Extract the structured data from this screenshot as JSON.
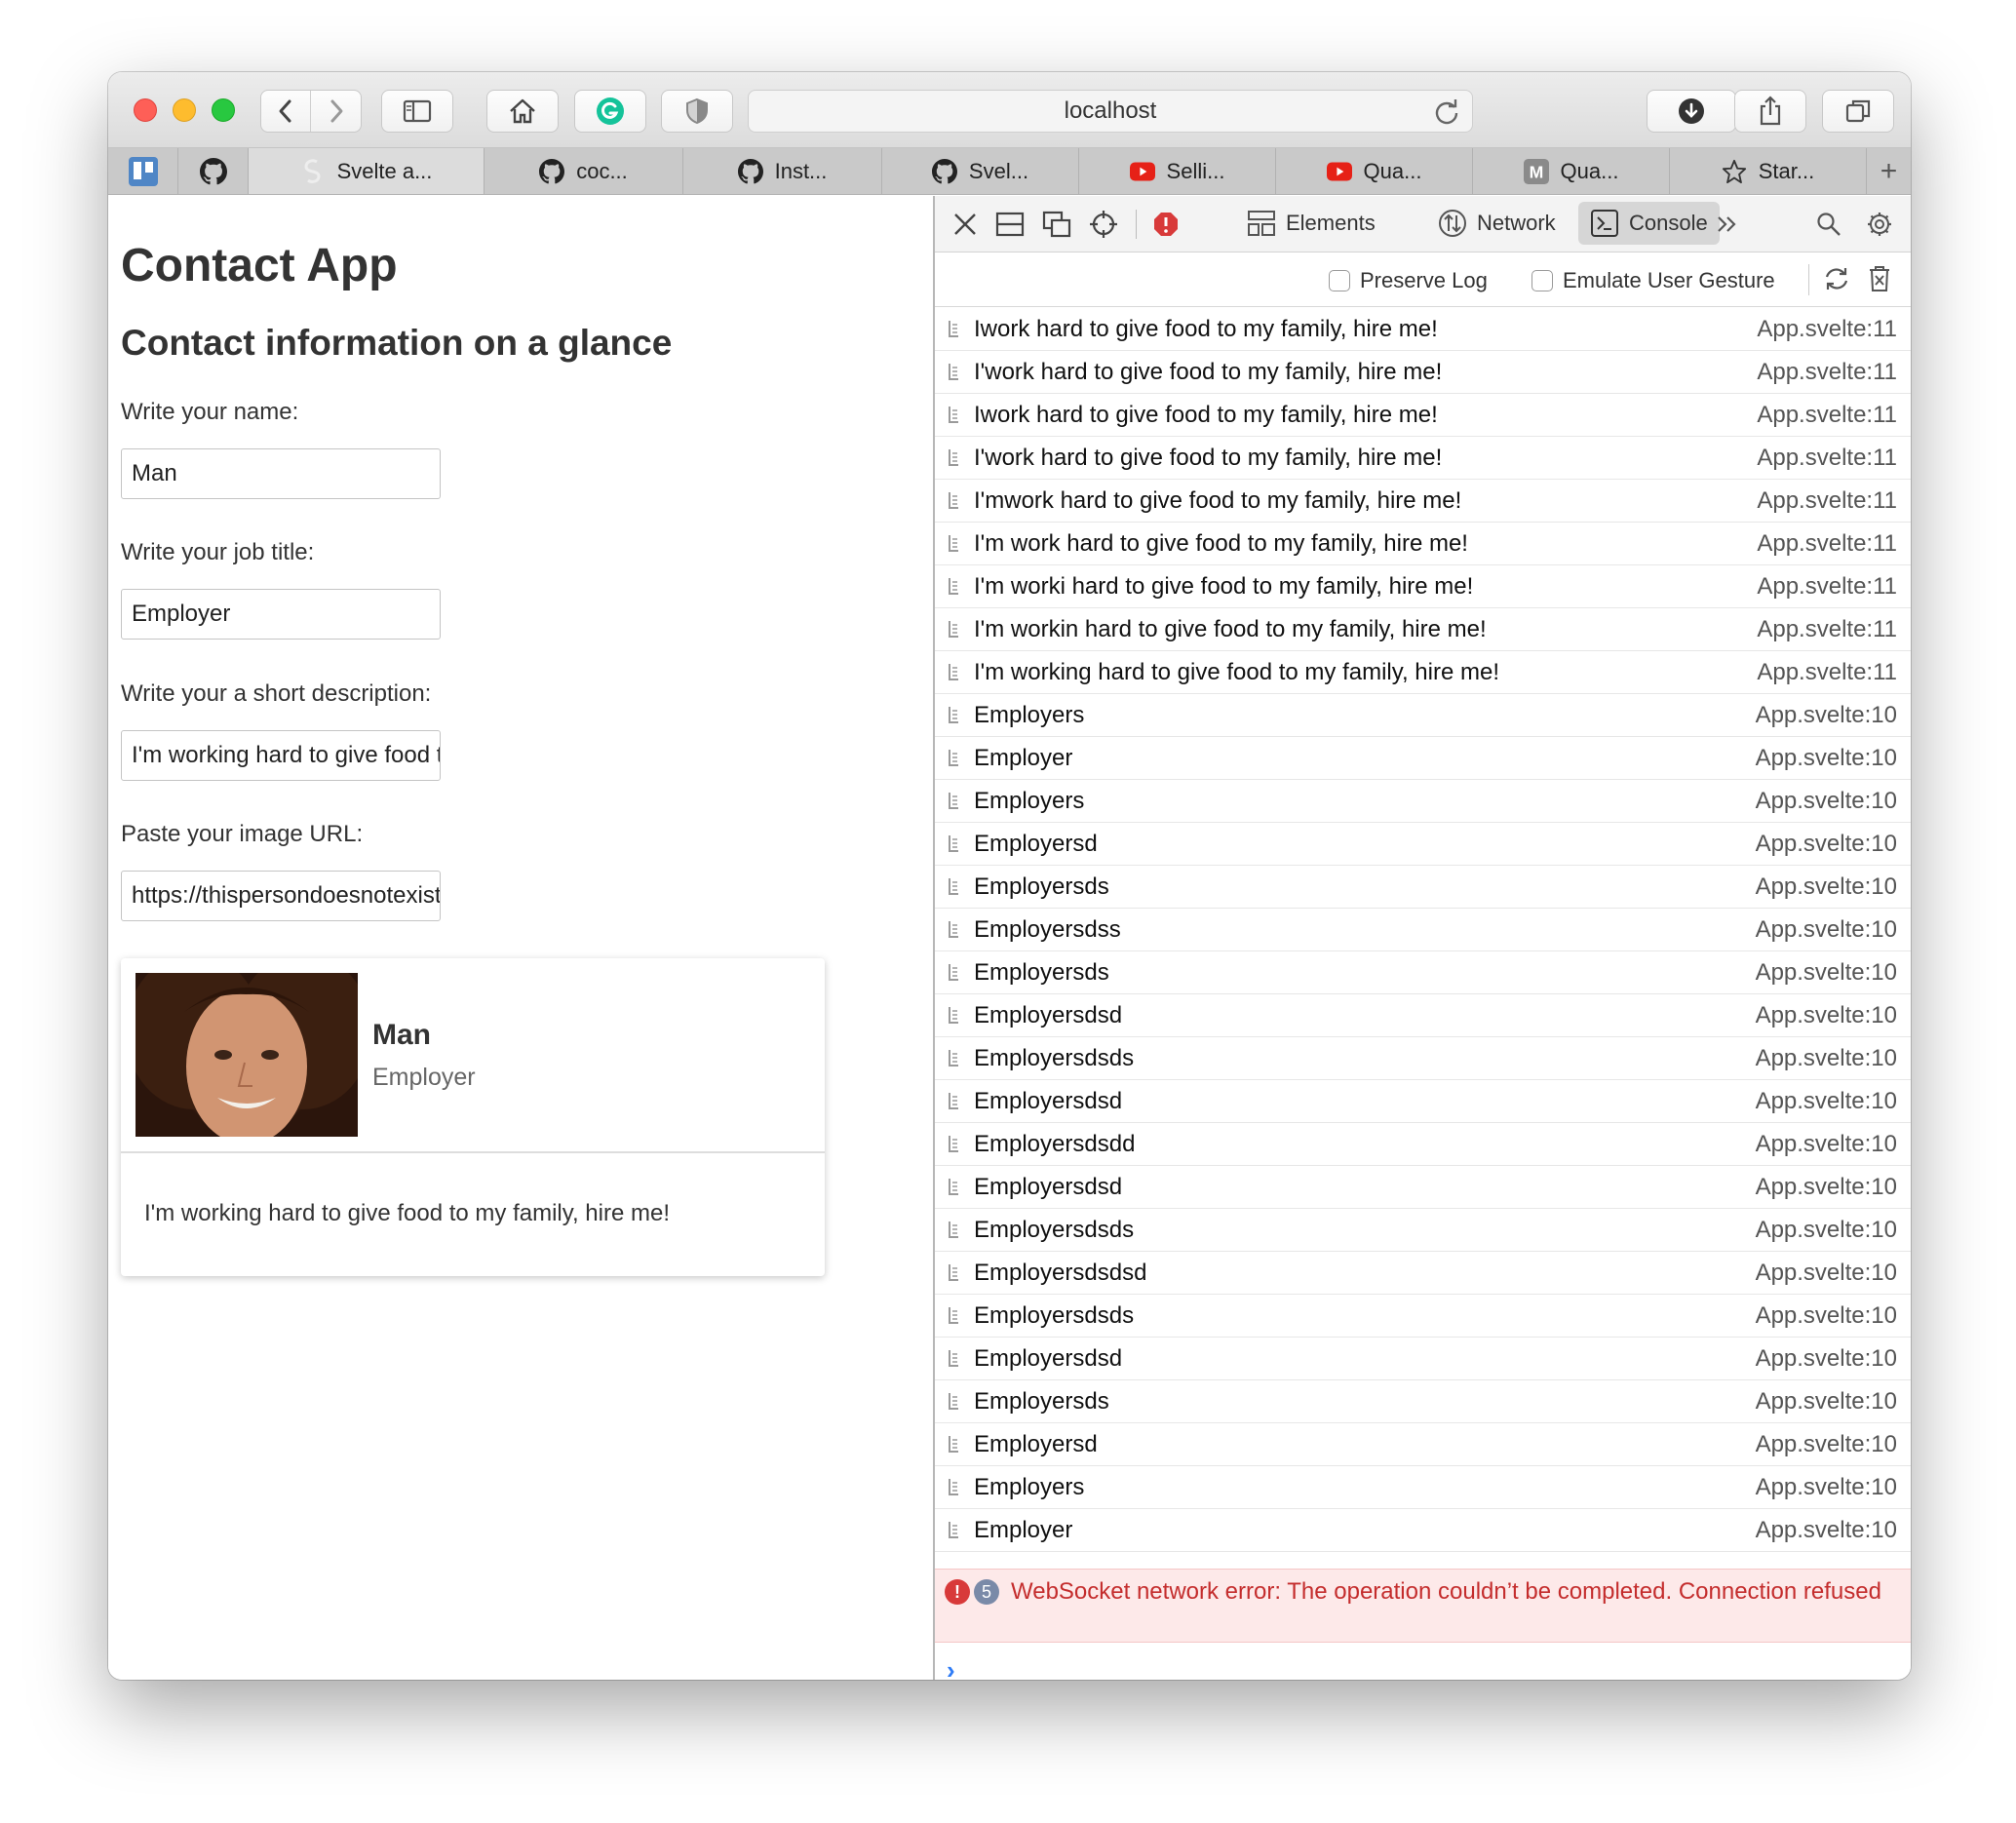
{
  "browser": {
    "url": "localhost",
    "tabs": [
      {
        "label": "Svelte a...",
        "icon": "svelte-icon",
        "active": true
      },
      {
        "label": "coc...",
        "icon": "github-icon"
      },
      {
        "label": "Inst...",
        "icon": "github-icon"
      },
      {
        "label": "Svel...",
        "icon": "github-icon"
      },
      {
        "label": "Selli...",
        "icon": "youtube-icon"
      },
      {
        "label": "Qua...",
        "icon": "youtube-icon"
      },
      {
        "label": "Qua...",
        "icon": "m-icon"
      },
      {
        "label": "Star...",
        "icon": "star-icon"
      }
    ],
    "new_tab": "+"
  },
  "page": {
    "title": "Contact App",
    "subtitle": "Contact information on a glance",
    "name_label": "Write your name:",
    "name_value": "Man",
    "job_label": "Write your job title:",
    "job_value": "Employer",
    "desc_label": "Write your a short description:",
    "desc_value": "I'm working hard to give food to my family, hire me!",
    "image_label": "Paste your image URL:",
    "image_value": "https://thispersondoesnotexist.com/image",
    "card": {
      "name": "Man",
      "job": "Employer",
      "description": "I'm working hard to give food to my family, hire me!"
    }
  },
  "devtools": {
    "tabs": {
      "elements": "Elements",
      "network": "Network",
      "console": "Console"
    },
    "preserve_log": "Preserve Log",
    "emulate_gesture": "Emulate User Gesture",
    "logs": [
      {
        "msg": "Iwork hard to give food to my family, hire me!",
        "src": "App.svelte:11"
      },
      {
        "msg": "I'work hard to give food to my family, hire me!",
        "src": "App.svelte:11"
      },
      {
        "msg": "Iwork hard to give food to my family, hire me!",
        "src": "App.svelte:11"
      },
      {
        "msg": "I'work hard to give food to my family, hire me!",
        "src": "App.svelte:11"
      },
      {
        "msg": "I'mwork hard to give food to my family, hire me!",
        "src": "App.svelte:11"
      },
      {
        "msg": "I'm work hard to give food to my family, hire me!",
        "src": "App.svelte:11"
      },
      {
        "msg": "I'm worki hard to give food to my family, hire me!",
        "src": "App.svelte:11"
      },
      {
        "msg": "I'm workin hard to give food to my family, hire me!",
        "src": "App.svelte:11"
      },
      {
        "msg": "I'm working hard to give food to my family, hire me!",
        "src": "App.svelte:11"
      },
      {
        "msg": "Employers",
        "src": "App.svelte:10"
      },
      {
        "msg": "Employer",
        "src": "App.svelte:10"
      },
      {
        "msg": "Employers",
        "src": "App.svelte:10"
      },
      {
        "msg": "Employersd",
        "src": "App.svelte:10"
      },
      {
        "msg": "Employersds",
        "src": "App.svelte:10"
      },
      {
        "msg": "Employersdss",
        "src": "App.svelte:10"
      },
      {
        "msg": "Employersds",
        "src": "App.svelte:10"
      },
      {
        "msg": "Employersdsd",
        "src": "App.svelte:10"
      },
      {
        "msg": "Employersdsds",
        "src": "App.svelte:10"
      },
      {
        "msg": "Employersdsd",
        "src": "App.svelte:10"
      },
      {
        "msg": "Employersdsdd",
        "src": "App.svelte:10"
      },
      {
        "msg": "Employersdsd",
        "src": "App.svelte:10"
      },
      {
        "msg": "Employersdsds",
        "src": "App.svelte:10"
      },
      {
        "msg": "Employersdsdsd",
        "src": "App.svelte:10"
      },
      {
        "msg": "Employersdsds",
        "src": "App.svelte:10"
      },
      {
        "msg": "Employersdsd",
        "src": "App.svelte:10"
      },
      {
        "msg": "Employersds",
        "src": "App.svelte:10"
      },
      {
        "msg": "Employersd",
        "src": "App.svelte:10"
      },
      {
        "msg": "Employers",
        "src": "App.svelte:10"
      },
      {
        "msg": "Employer",
        "src": "App.svelte:10"
      }
    ],
    "error": {
      "count": "5",
      "text": "WebSocket network error: The operation couldn’t be completed. Connection refused"
    },
    "prompt": "›"
  }
}
